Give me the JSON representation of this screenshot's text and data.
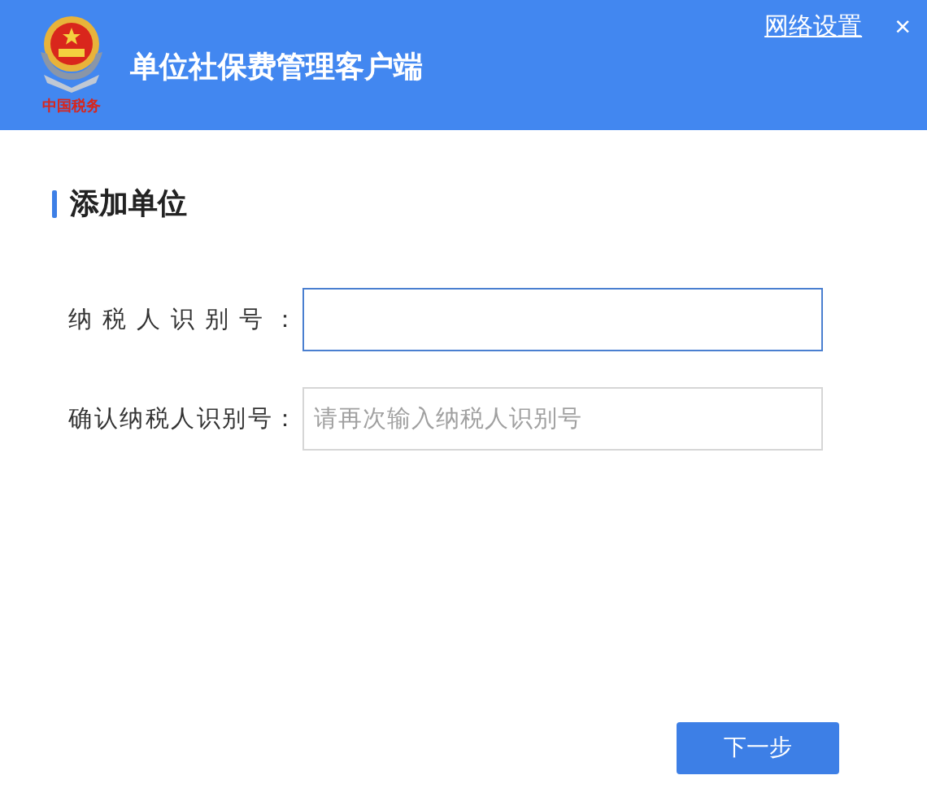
{
  "window": {
    "title": "单位社保费管理客户端",
    "logo_text": "中国税务",
    "network_link": "网络设置",
    "close": "×"
  },
  "section": {
    "title": "添加单位"
  },
  "fields": [
    {
      "label": "纳税人识别号：",
      "focused": true
    },
    {
      "label": "确认纳税人识别号：",
      "placeholder": "请再次输入纳税人识别号",
      "focused": false
    }
  ],
  "buttons": [
    "下一步"
  ]
}
